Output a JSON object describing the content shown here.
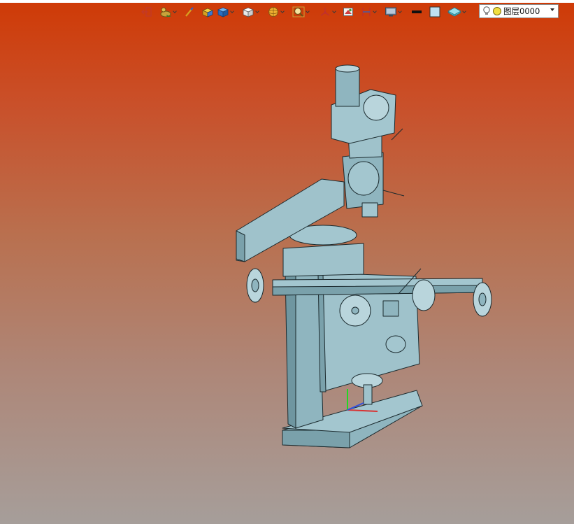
{
  "toolbar": {
    "items": [
      {
        "icon": "exit-icon",
        "dropdown": false
      },
      {
        "icon": "duck-shape-icon",
        "dropdown": true
      },
      {
        "icon": "pen-icon",
        "dropdown": false
      },
      {
        "icon": "yellow-box-icon",
        "dropdown": false
      },
      {
        "icon": "blue-box-icon",
        "dropdown": true
      },
      {
        "icon": "white-box-icon",
        "dropdown": true
      },
      {
        "icon": "sphere-icon",
        "dropdown": true
      },
      {
        "icon": "zoom-icon",
        "dropdown": true
      },
      {
        "icon": "axis-triad-icon",
        "dropdown": true
      },
      {
        "icon": "section-view-icon",
        "dropdown": false
      },
      {
        "icon": "dimension-icon",
        "dropdown": true
      },
      {
        "icon": "display-monitor-icon",
        "dropdown": true
      },
      {
        "icon": "line-color-icon",
        "dropdown": false
      },
      {
        "icon": "fill-color-icon",
        "dropdown": false
      },
      {
        "icon": "layer-plane-icon",
        "dropdown": true
      }
    ],
    "colors": {
      "line": "#111111",
      "fill": "#bfe0f2"
    }
  },
  "layer": {
    "value": "图层0000",
    "icons": [
      "lightbulb-icon",
      "sun-icon"
    ]
  },
  "viewport": {
    "background_top": "#cf3a06",
    "background_bottom": "#a69e9a",
    "model_color": "#8fb5bf",
    "model": "milling-machine"
  }
}
